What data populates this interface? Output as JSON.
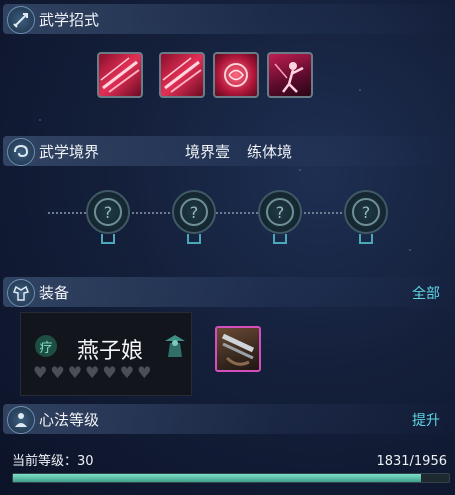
{
  "skills": {
    "title": "武学招式",
    "items": [
      {
        "name": "skill-slash-1"
      },
      {
        "name": "skill-slash-2"
      },
      {
        "name": "skill-rose"
      },
      {
        "name": "skill-warrior"
      }
    ]
  },
  "realm": {
    "title": "武学境界",
    "level": "境界壹",
    "stage": "练体境",
    "nodes": 4
  },
  "equipment": {
    "title": "装备",
    "all_link": "全部",
    "card_type": "疗",
    "card_name": "燕子娘",
    "hearts_total": 7,
    "hearts_filled": 0
  },
  "heart_method": {
    "title": "心法等级",
    "upgrade_link": "提升",
    "level_label": "当前等级：30",
    "progress_text": "1831/1956",
    "progress_value": 1831,
    "progress_max": 1956
  },
  "colors": {
    "accent": "#5fd6e6",
    "progress": "#4fc4a8",
    "equip_border": "#d24fbc"
  }
}
